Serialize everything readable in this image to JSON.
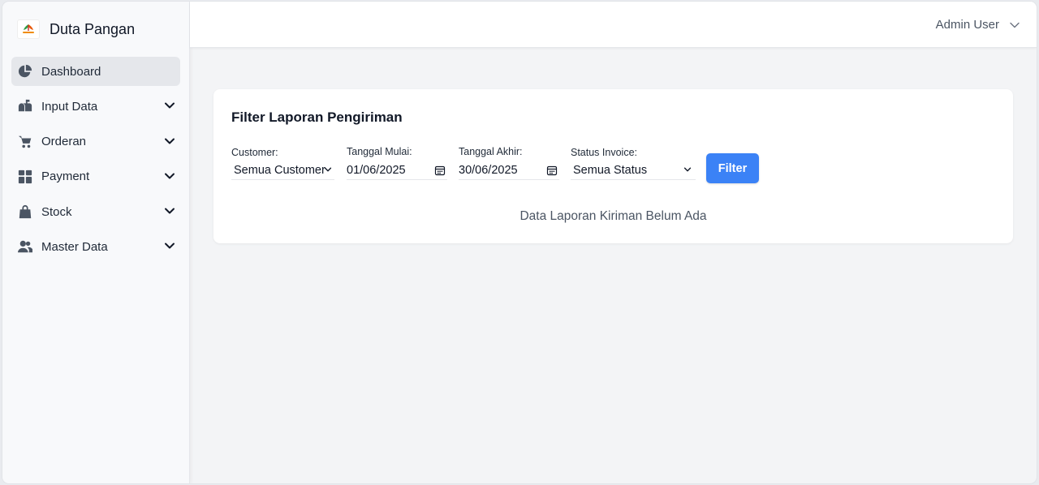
{
  "brand": {
    "name": "Duta Pangan",
    "logo_text": "DutaPangan"
  },
  "sidebar": {
    "items": [
      {
        "label": "Dashboard",
        "icon": "pie-chart-icon",
        "active": true,
        "has_submenu": false
      },
      {
        "label": "Input Data",
        "icon": "mailbox-icon",
        "active": false,
        "has_submenu": true
      },
      {
        "label": "Orderan",
        "icon": "cart-icon",
        "active": false,
        "has_submenu": true
      },
      {
        "label": "Payment",
        "icon": "grid-icon",
        "active": false,
        "has_submenu": true
      },
      {
        "label": "Stock",
        "icon": "shopping-bag-icon",
        "active": false,
        "has_submenu": true
      },
      {
        "label": "Master Data",
        "icon": "users-icon",
        "active": false,
        "has_submenu": true
      }
    ]
  },
  "header": {
    "user_name": "Admin User"
  },
  "report": {
    "title": "Filter Laporan Pengiriman",
    "customer": {
      "label": "Customer:",
      "value": "Semua Customer"
    },
    "start_date": {
      "label": "Tanggal Mulai:",
      "value": "01/06/2025"
    },
    "end_date": {
      "label": "Tanggal Akhir:",
      "value": "30/06/2025"
    },
    "status": {
      "label": "Status Invoice:",
      "value": "Semua Status"
    },
    "filter_label": "Filter",
    "empty_message": "Data Laporan Kiriman Belum Ada"
  },
  "colors": {
    "accent": "#3b82f6",
    "sidebar_bg": "#f8f9fb",
    "active_bg": "#e5e7eb"
  }
}
